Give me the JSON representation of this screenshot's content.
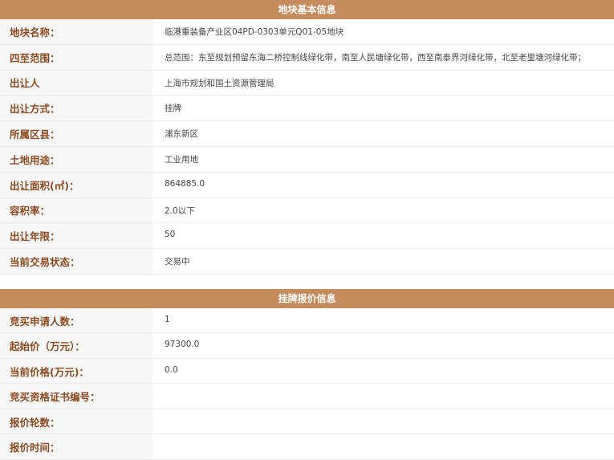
{
  "basic_info": {
    "title": "地块基本信息",
    "rows": [
      {
        "label": "地块名称：",
        "value": "临港重装备产业区04PD-0303单元Q01-05地块"
      },
      {
        "label": "四至范围：",
        "value": "总范围：东至规划预留东海二桥控制线绿化带，南至人民塘绿化带，西至南泰界河绿化带，北至老里塘河绿化带；"
      },
      {
        "label": "出让人",
        "value": "上海市规划和国土资源管理局"
      },
      {
        "label": "出让方式：",
        "value": "挂牌"
      },
      {
        "label": "所属区县：",
        "value": "浦东新区"
      },
      {
        "label": "土地用途：",
        "value": "工业用地"
      },
      {
        "label": "出让面积(㎡)：",
        "value": "864885.0"
      },
      {
        "label": "容积率：",
        "value": "2.0以下"
      },
      {
        "label": "出让年限：",
        "value": "50"
      },
      {
        "label": "当前交易状态：",
        "value": "交易中"
      }
    ]
  },
  "quote_info": {
    "title": "挂牌报价信息",
    "rows": [
      {
        "label": "竞买申请人数：",
        "value": "1"
      },
      {
        "label": "起始价（万元）：",
        "value": "97300.0"
      },
      {
        "label": "当前价格(万元)：",
        "value": "0.0"
      },
      {
        "label": "竞买资格证书编号：",
        "value": ""
      },
      {
        "label": "报价轮数：",
        "value": ""
      },
      {
        "label": "报价时间：",
        "value": ""
      }
    ]
  }
}
